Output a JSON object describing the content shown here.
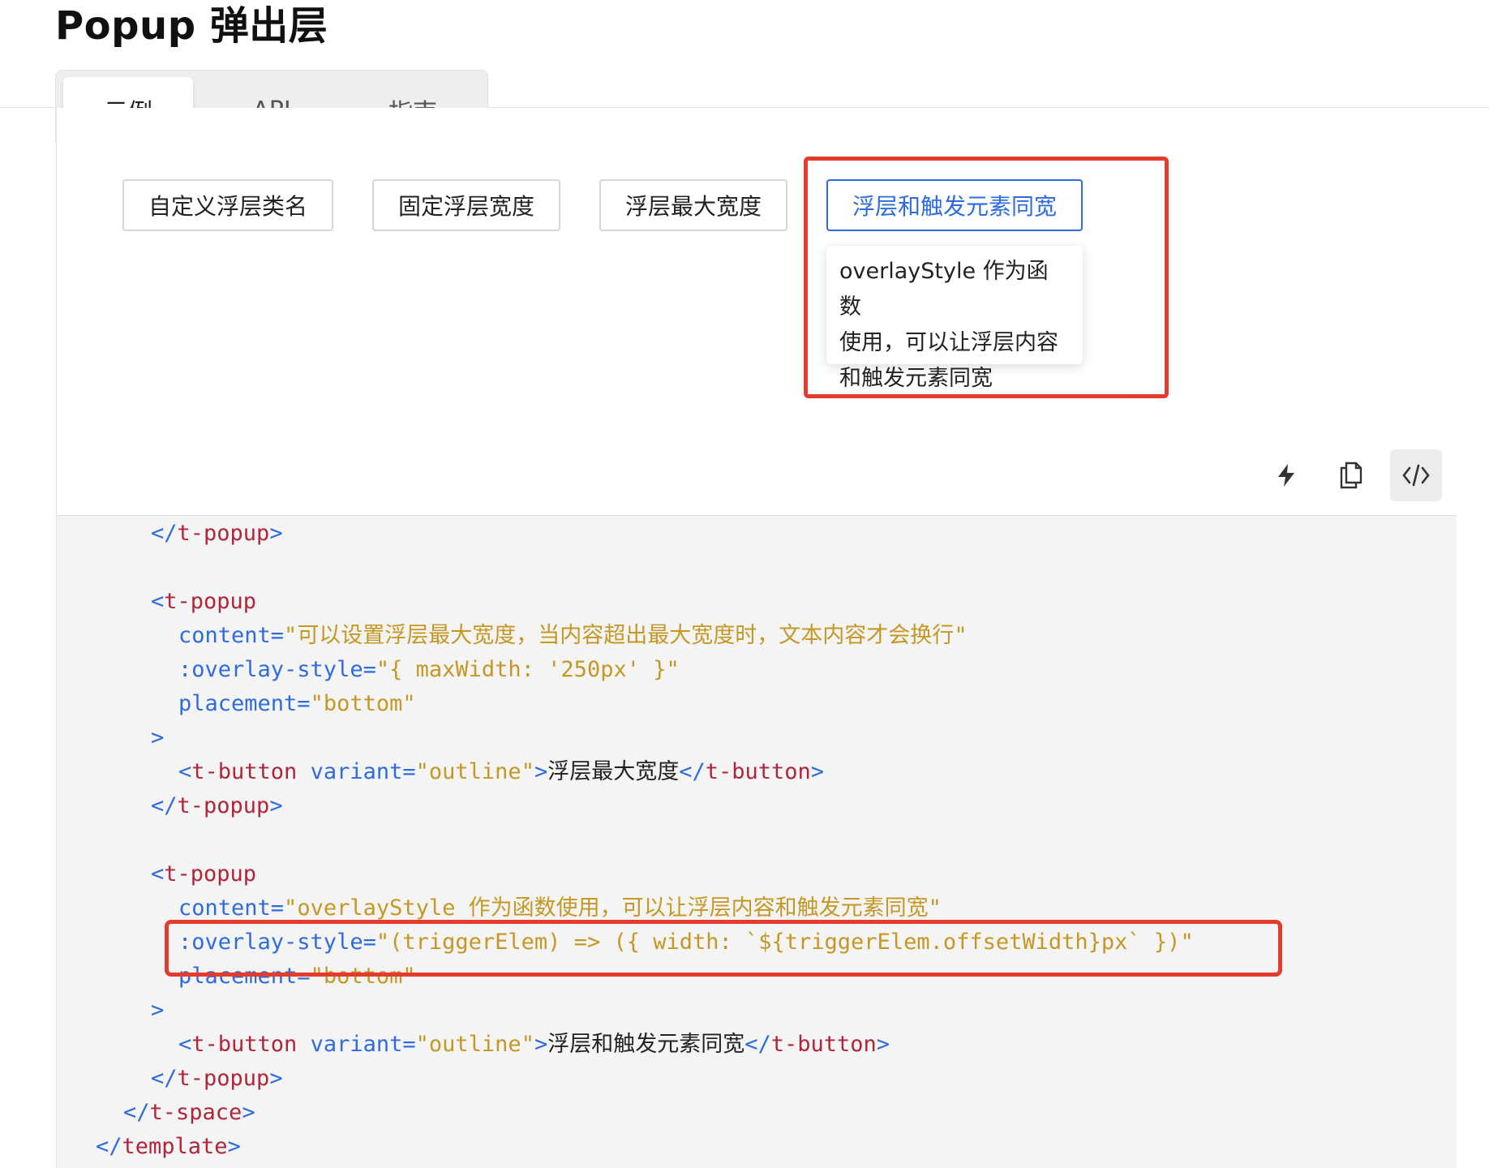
{
  "page": {
    "title": "Popup 弹出层"
  },
  "tabs": [
    {
      "label": "示例",
      "active": true
    },
    {
      "label": "API",
      "active": false
    },
    {
      "label": "指南",
      "active": false
    }
  ],
  "demo": {
    "buttons": [
      {
        "label": "自定义浮层类名"
      },
      {
        "label": "固定浮层宽度"
      },
      {
        "label": "浮层最大宽度"
      },
      {
        "label": "浮层和触发元素同宽"
      }
    ],
    "popup": {
      "lines": [
        "overlayStyle 作为函数",
        "使用，可以让浮层内容",
        "和触发元素同宽"
      ]
    },
    "toolbar": [
      {
        "icon": "lightning-icon"
      },
      {
        "icon": "copy-icon"
      },
      {
        "icon": "code-icon"
      }
    ]
  },
  "code": {
    "close_popup": "t-popup",
    "open_popup": "t-popup",
    "content_attr": "content=",
    "content_max": "可以设置浮层最大宽度，当内容超出最大宽度时，文本内容才会换行",
    "overlay_attr": ":overlay-style=",
    "overlay_max": "{ maxWidth: '250px' }",
    "placement_attr": "placement=",
    "placement_val": "bottom",
    "button_tag": "t-button",
    "variant_attr": "variant=",
    "variant_val": "outline",
    "btn_text_max": "浮层最大宽度",
    "content_same": "overlayStyle 作为函数使用，可以让浮层内容和触发元素同宽",
    "overlay_same": "(triggerElem) => ({ width: `${triggerElem.offsetWidth}px` })",
    "btn_text_same": "浮层和触发元素同宽",
    "space_tag": "t-space",
    "template_tag": "template"
  },
  "colors": {
    "accent": "#2d6bdf",
    "highlight": "#e53b2c",
    "tag": "#b0253a",
    "string": "#c59724"
  }
}
